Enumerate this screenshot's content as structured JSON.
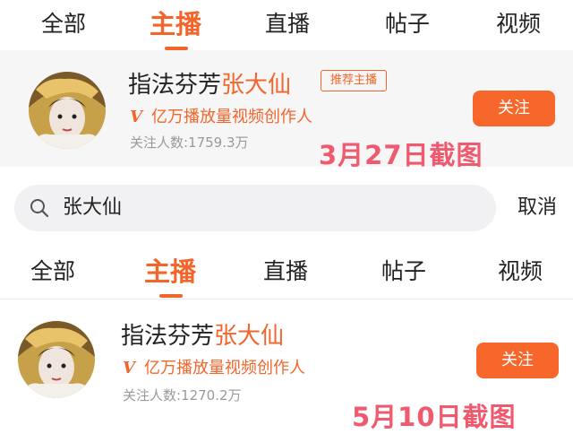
{
  "tabs_top": [
    "全部",
    "主播",
    "直播",
    "帖子",
    "视频"
  ],
  "tabs_bottom": [
    "全部",
    "主播",
    "直播",
    "帖子",
    "视频"
  ],
  "result_top": {
    "name_prefix": "指法芬芳",
    "name_highlight": "张大仙",
    "badge": "推荐主播",
    "verify_mark": "V",
    "verify_text": "亿万播放量视频创作人",
    "followers": "关注人数:1759.3万",
    "follow_label": "关注"
  },
  "stamp_top": "3月27日截图",
  "search": {
    "query": "张大仙",
    "cancel_label": "取消"
  },
  "result_bottom": {
    "name_prefix": "指法芬芳",
    "name_highlight": "张大仙",
    "verify_mark": "V",
    "verify_text": "亿万播放量视频创作人",
    "followers": "关注人数:1270.2万",
    "follow_label": "关注"
  },
  "stamp_bottom": "5月10日截图",
  "colors": {
    "accent": "#f2652b",
    "stamp": "#ef5a6f",
    "card_bg": "#f6f6f6"
  },
  "icons": {
    "search": "search-icon",
    "avatar": "avatar"
  }
}
